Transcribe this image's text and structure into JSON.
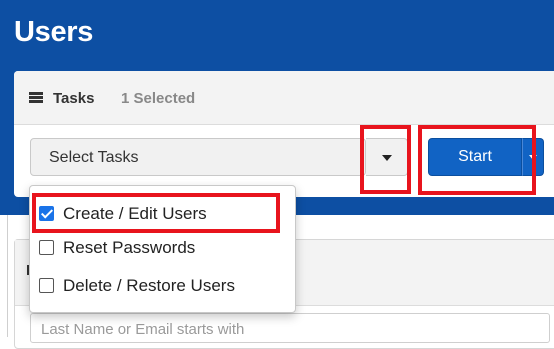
{
  "page": {
    "title": "Users"
  },
  "tasks": {
    "title": "Tasks",
    "selected_count": "1 Selected",
    "select_placeholder": "Select Tasks",
    "start_label": "Start",
    "options": [
      {
        "label": "Create / Edit Users",
        "checked": true
      },
      {
        "label": "Reset Passwords",
        "checked": false
      },
      {
        "label": "Delete / Restore Users",
        "checked": false
      }
    ]
  },
  "search": {
    "heading": "F",
    "placeholder": "Last Name or Email starts with"
  },
  "icons": {
    "tasks": "list-icon",
    "select_caret": "caret-down-icon",
    "start_caret": "caret-down-icon"
  },
  "colors": {
    "header_blue": "#0d4fa3",
    "button_blue": "#1163c4",
    "highlight_red": "#e8141d",
    "checkbox_blue": "#1a73e8"
  }
}
